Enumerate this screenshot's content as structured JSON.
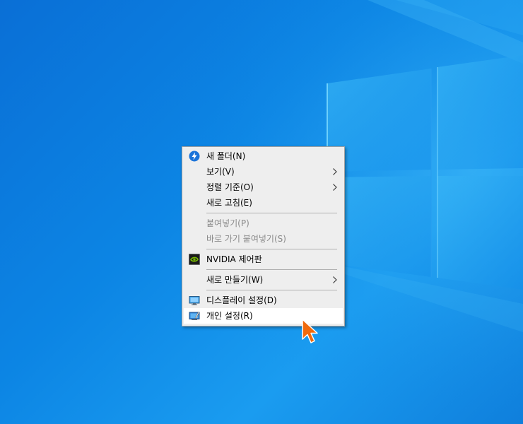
{
  "desktop": {
    "wallpaper_color": "#0c85e4",
    "accent_color": "#1a9cf0"
  },
  "context_menu": {
    "items": [
      {
        "label": "새 폴더(N)",
        "icon": "new-folder-bolt-icon",
        "disabled": false,
        "submenu": false
      },
      {
        "label": "보기(V)",
        "icon": "",
        "disabled": false,
        "submenu": true
      },
      {
        "label": "정렬 기준(O)",
        "icon": "",
        "disabled": false,
        "submenu": true
      },
      {
        "label": "새로 고침(E)",
        "icon": "",
        "disabled": false,
        "submenu": false
      },
      {
        "label": "붙여넣기(P)",
        "icon": "",
        "disabled": true,
        "submenu": false
      },
      {
        "label": "바로 가기 붙여넣기(S)",
        "icon": "",
        "disabled": true,
        "submenu": false
      },
      {
        "label": "NVIDIA 제어판",
        "icon": "nvidia-logo-icon",
        "disabled": false,
        "submenu": false
      },
      {
        "label": "새로 만들기(W)",
        "icon": "",
        "disabled": false,
        "submenu": true
      },
      {
        "label": "디스플레이 설정(D)",
        "icon": "display-settings-icon",
        "disabled": false,
        "submenu": false
      },
      {
        "label": "개인 설정(R)",
        "icon": "personalize-icon",
        "disabled": false,
        "submenu": false,
        "hovered": true
      }
    ]
  },
  "cursor": {
    "color": "#f06a0c"
  }
}
